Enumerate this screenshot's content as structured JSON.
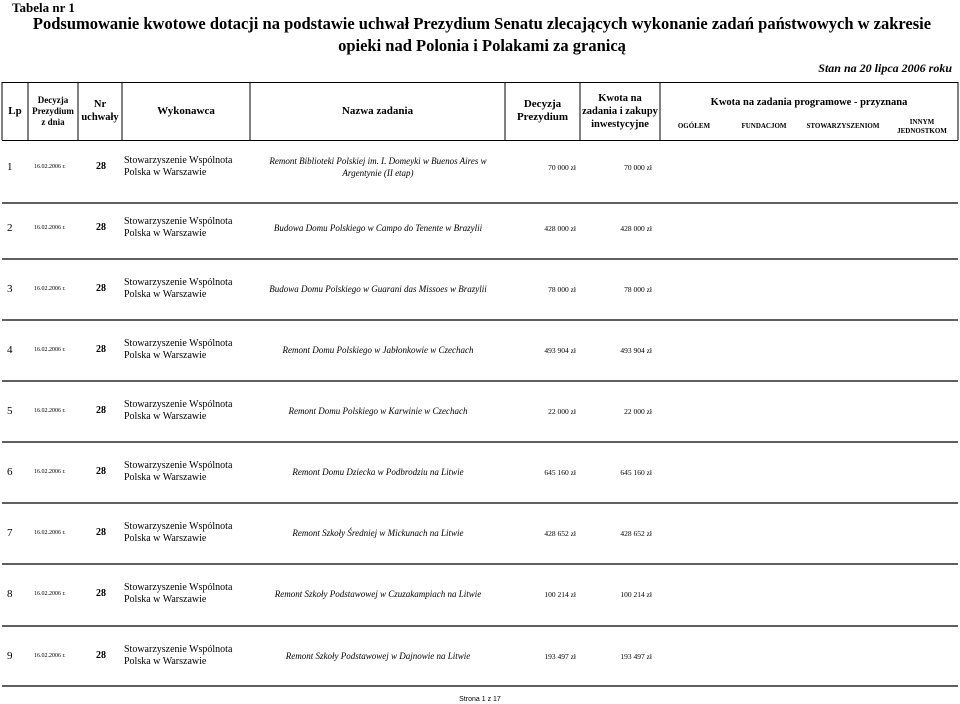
{
  "doc": {
    "table_no": "Tabela nr 1",
    "title": "Podsumowanie kwotowe dotacji na podstawie uchwał Prezydium Senatu zlecających wykonanie zadań państwowych w zakresie opieki nad Polonia i Polakami za granicą",
    "status": "Stan na 20 lipca 2006 roku",
    "footer": "Strona 1 z 17"
  },
  "headers": {
    "lp": "Lp",
    "decyzja_z_dnia": "Decyzja Prezydium z dnia",
    "nr_uchwaly": "Nr uchwały",
    "wykonawca": "Wykonawca",
    "nazwa": "Nazwa zadania",
    "decyzja": "Decyzja Prezydium",
    "kwota_inw": "Kwota na zadania i zakupy inwestycyjne",
    "kwota_prog": "Kwota na zadania programowe - przyznana",
    "ogolem": "OGÓŁEM",
    "fundacjom": "FUNDACJOM",
    "stowarzyszeniom": "STOWARZYSZENIOM",
    "innym": "INNYM JEDNOSTKOM"
  },
  "rows": [
    {
      "lp": "1",
      "date": "16.02.2006 r.",
      "nr": "28",
      "wykonawca": "Stowarzyszenie Wspólnota Polska w Warszawie",
      "nazwa": "Remont Biblioteki Polskiej im. I. Domeyki w Buenos Aires w Argentynie (II etap)",
      "kwota": "70 000 zł",
      "ogolem": "70 000 zł"
    },
    {
      "lp": "2",
      "date": "16.02.2006 r.",
      "nr": "28",
      "wykonawca": "Stowarzyszenie Wspólnota Polska w Warszawie",
      "nazwa": "Budowa Domu Polskiego w Campo do Tenente w Brazylii",
      "kwota": "428 000 zł",
      "ogolem": "428 000 zł"
    },
    {
      "lp": "3",
      "date": "16.02.2006 r.",
      "nr": "28",
      "wykonawca": "Stowarzyszenie Wspólnota Polska w Warszawie",
      "nazwa": "Budowa Domu Polskiego w Guarani das Missoes w Brazylii",
      "kwota": "78 000 zł",
      "ogolem": "78 000 zł"
    },
    {
      "lp": "4",
      "date": "16.02.2006 r.",
      "nr": "28",
      "wykonawca": "Stowarzyszenie Wspólnota Polska w Warszawie",
      "nazwa": "Remont Domu Polskiego w Jabłonkowie w Czechach",
      "kwota": "493 904 zł",
      "ogolem": "493 904 zł"
    },
    {
      "lp": "5",
      "date": "16.02.2006 r.",
      "nr": "28",
      "wykonawca": "Stowarzyszenie Wspólnota Polska w Warszawie",
      "nazwa": "Remont Domu Polskiego w Karwinie w Czechach",
      "kwota": "22 000 zł",
      "ogolem": "22 000 zł"
    },
    {
      "lp": "6",
      "date": "16.02.2006 r.",
      "nr": "28",
      "wykonawca": "Stowarzyszenie Wspólnota Polska w Warszawie",
      "nazwa": "Remont Domu Dziecka w Podbrodziu na Litwie",
      "kwota": "645 160 zł",
      "ogolem": "645 160 zł"
    },
    {
      "lp": "7",
      "date": "16.02.2006 r.",
      "nr": "28",
      "wykonawca": "Stowarzyszenie Wspólnota Polska w Warszawie",
      "nazwa": "Remont Szkoły Średniej w Mickunach na Litwie",
      "kwota": "428 652 zł",
      "ogolem": "428 652 zł"
    },
    {
      "lp": "8",
      "date": "16.02.2006 r.",
      "nr": "28",
      "wykonawca": "Stowarzyszenie Wspólnota Polska w Warszawie",
      "nazwa": "Remont Szkoły Podstawowej w Czuzakampiach na Litwie",
      "kwota": "100 214 zł",
      "ogolem": "100 214 zł"
    },
    {
      "lp": "9",
      "date": "16.02.2006 r.",
      "nr": "28",
      "wykonawca": "Stowarzyszenie Wspólnota Polska w Warszawie",
      "nazwa": "Remont Szkoły Podstawowej w Dajnowie na Litwie",
      "kwota": "193 497 zł",
      "ogolem": "193 497 zł"
    }
  ]
}
